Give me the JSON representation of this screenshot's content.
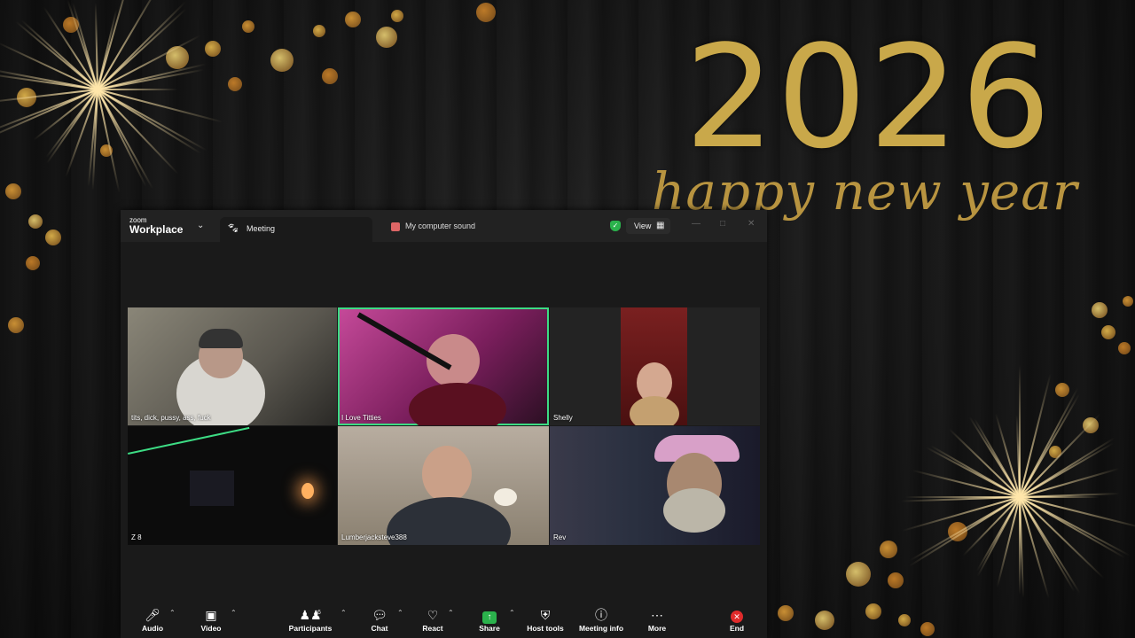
{
  "background": {
    "year_text": "2026",
    "tagline": "happy new year",
    "colors": {
      "gold": "#c9a84a",
      "wood": "#1c1c1c"
    }
  },
  "window": {
    "app_name_small": "zoom",
    "app_name": "Workplace",
    "tab_meeting": "Meeting",
    "audio_source": "My computer sound",
    "view_label": "View",
    "icons": {
      "menu": "chevron-down-icon",
      "meeting": "paw-icon",
      "security": "shield-check-icon",
      "view": "grid-icon",
      "minimize": "minimize-icon",
      "maximize": "maximize-icon",
      "close": "close-icon"
    }
  },
  "participants": [
    {
      "name": "tits, dick, pussy, ass, fuck",
      "active": false
    },
    {
      "name": "I Love Titties",
      "active": true
    },
    {
      "name": "Shelly",
      "active": false
    },
    {
      "name": "Z 8",
      "active": false
    },
    {
      "name": "Lumberjacksteve388",
      "active": false
    },
    {
      "name": "Rev",
      "active": false
    }
  ],
  "toolbar": {
    "audio": "Audio",
    "video": "Video",
    "participants": "Participants",
    "participants_count": "6",
    "chat": "Chat",
    "react": "React",
    "share": "Share",
    "host_tools": "Host tools",
    "meeting_info": "Meeting info",
    "more": "More",
    "end": "End",
    "accent_active": "#3ddc84",
    "end_color": "#e02b2b"
  }
}
